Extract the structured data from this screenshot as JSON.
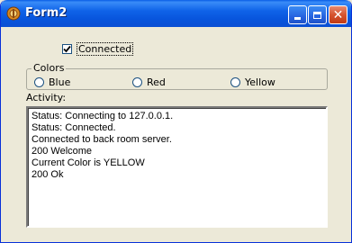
{
  "window": {
    "title": "Form2"
  },
  "connected": {
    "label": "Connected",
    "checked": true
  },
  "colors": {
    "legend": "Colors",
    "options": [
      "Blue",
      "Red",
      "Yellow"
    ]
  },
  "activity": {
    "label": "Activity:",
    "lines": [
      "Status: Connecting to 127.0.0.1.",
      "Status: Connected.",
      "Connected to back room server.",
      "200 Welcome",
      "Current Color is YELLOW",
      "200 Ok"
    ]
  },
  "icons": {
    "app": "app-icon",
    "minimize": "minimize-icon",
    "maximize": "maximize-icon",
    "close": "close-icon",
    "checkmark": "checkmark-icon"
  }
}
